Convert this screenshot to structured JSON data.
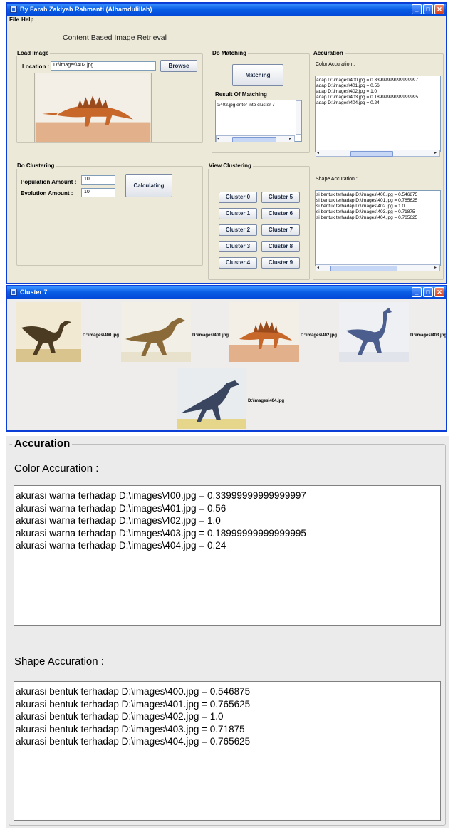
{
  "main_window": {
    "title": "By Farah Zakiyah Rahmanti (Alhamdulillah)",
    "menu": [
      "File",
      "Help"
    ],
    "app_title": "Content Based Image Retrieval",
    "load_image": {
      "legend": "Load Image",
      "location_label": "Location :",
      "location_value": "D:\\images\\402.jpg",
      "browse_label": "Browse"
    },
    "do_matching": {
      "legend": "Do Matching",
      "matching_label": "Matching",
      "result_label": "Result Of Matching",
      "result_text": "s\\402.jpg enter into cluster 7"
    },
    "accuration": {
      "legend": "Accuration",
      "color_label": "Color Accuration :",
      "color_lines": [
        "adap D:\\images\\400.jpg = 0.33999999999999997",
        "adap D:\\images\\401.jpg = 0.56",
        "adap D:\\images\\402.jpg = 1.0",
        "adap D:\\images\\403.jpg = 0.18999999999999995",
        "adap D:\\images\\404.jpg = 0.24"
      ],
      "shape_label": "Shape Accuration :",
      "shape_lines": [
        "si bentuk terhadap D:\\images\\400.jpg = 0.546875",
        "si bentuk terhadap D:\\images\\401.jpg = 0.765625",
        "si bentuk terhadap D:\\images\\402.jpg = 1.0",
        "si bentuk terhadap D:\\images\\403.jpg = 0.71875",
        "si bentuk terhadap D:\\images\\404.jpg = 0.765625"
      ]
    },
    "do_clustering": {
      "legend": "Do Clustering",
      "population_label": "Population Amount :",
      "population_value": "10",
      "evolution_label": "Evolution Amount :",
      "evolution_value": "10",
      "calculating_label": "Calculating"
    },
    "view_clustering": {
      "legend": "View Clustering",
      "buttons": [
        "Cluster 0",
        "Cluster 5",
        "Cluster 1",
        "Cluster 6",
        "Cluster 2",
        "Cluster 7",
        "Cluster 3",
        "Cluster 8",
        "Cluster 4",
        "Cluster 9"
      ]
    }
  },
  "cluster_window": {
    "title": "Cluster 7",
    "images": [
      {
        "caption": "D:\\images\\400.jpg",
        "bg": "#f1e9d2",
        "body": "#4a3b22",
        "ground": "#d9c48e"
      },
      {
        "caption": "D:\\images\\401.jpg",
        "bg": "#f2efe6",
        "body": "#8a6a38",
        "ground": "#e8e1cc"
      },
      {
        "caption": "D:\\images\\402.jpg",
        "bg": "#f3eee6",
        "body": "#c8672a",
        "ground": "#e2b08a"
      },
      {
        "caption": "D:\\images\\403.jpg",
        "bg": "#eef0f3",
        "body": "#4b5e8e",
        "ground": "#e1e4ea"
      },
      {
        "caption": "D:\\images\\404.jpg",
        "bg": "#e9ecef",
        "body": "#3a4660",
        "ground": "#e6d68c"
      }
    ]
  },
  "zoom_panel": {
    "legend": "Accuration",
    "color_label": "Color Accuration :",
    "color_lines": [
      "akurasi warna terhadap D:\\images\\400.jpg = 0.33999999999999997",
      "akurasi warna terhadap D:\\images\\401.jpg = 0.56",
      "akurasi warna terhadap D:\\images\\402.jpg = 1.0",
      "akurasi warna terhadap D:\\images\\403.jpg = 0.18999999999999995",
      "akurasi warna terhadap D:\\images\\404.jpg = 0.24"
    ],
    "shape_label": "Shape Accuration :",
    "shape_lines": [
      "akurasi bentuk terhadap D:\\images\\400.jpg = 0.546875",
      "akurasi bentuk terhadap D:\\images\\401.jpg = 0.765625",
      "akurasi bentuk terhadap D:\\images\\402.jpg = 1.0",
      "akurasi bentuk terhadap D:\\images\\403.jpg = 0.71875",
      "akurasi bentuk terhadap D:\\images\\404.jpg = 0.765625"
    ]
  }
}
